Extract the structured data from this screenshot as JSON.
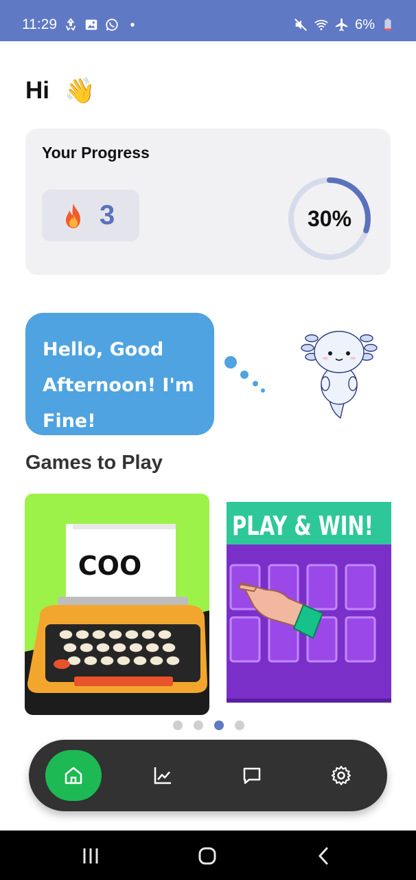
{
  "status_bar": {
    "time": "11:29",
    "battery": "6%",
    "left_icons": [
      "sync-icon",
      "image-icon",
      "whatsapp-icon",
      "dot-icon"
    ],
    "right_icons": [
      "mute-icon",
      "wifi-icon",
      "airplane-icon",
      "battery-icon"
    ],
    "background": "#6079c4"
  },
  "greeting": {
    "text": "Hi",
    "emoji": "👋"
  },
  "progress": {
    "title": "Your Progress",
    "streak_count": "3",
    "percent_label": "30%",
    "percent_value": 0.3,
    "accent": "#5a72bd"
  },
  "bubble": {
    "text": "Hello, Good Afternoon! I'm Fine!"
  },
  "games": {
    "title": "Games to Play",
    "card1": {
      "banner_text": "COO"
    },
    "card2": {
      "banner_text": "PLAY & WIN!"
    },
    "carousel_active_index": 2,
    "carousel_count": 4
  },
  "bottom_nav": {
    "items": [
      "home-icon",
      "chart-icon",
      "chat-icon",
      "settings-icon"
    ],
    "active": "home-icon",
    "active_color": "#1db954"
  }
}
